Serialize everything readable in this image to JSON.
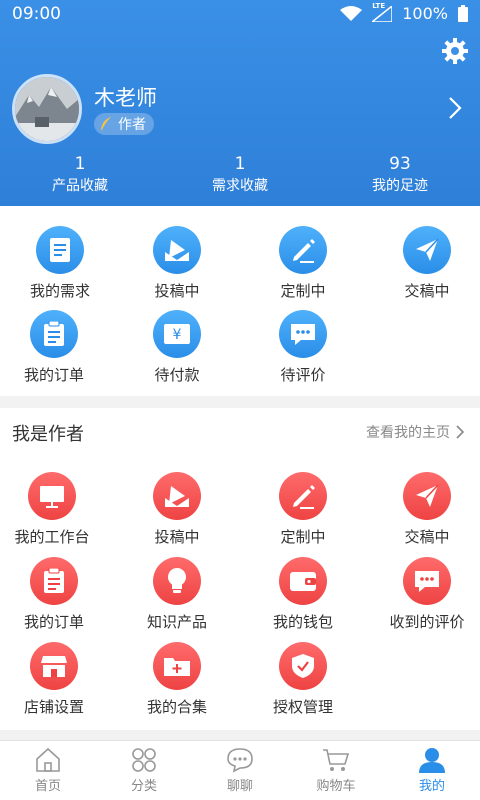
{
  "status": {
    "time": "09:00",
    "network": "LTE",
    "battery": "100%"
  },
  "profile": {
    "name": "木老师",
    "role": "作者"
  },
  "stats": [
    {
      "value": "1",
      "label": "产品收藏"
    },
    {
      "value": "1",
      "label": "需求收藏"
    },
    {
      "value": "93",
      "label": "我的足迹"
    }
  ],
  "buyer_menu": [
    {
      "label": "我的需求",
      "icon": "document-icon"
    },
    {
      "label": "投稿中",
      "icon": "envelope-icon"
    },
    {
      "label": "定制中",
      "icon": "pencil-icon"
    },
    {
      "label": "交稿中",
      "icon": "paper-plane-icon"
    },
    {
      "label": "我的订单",
      "icon": "order-icon"
    },
    {
      "label": "待付款",
      "icon": "yen-icon"
    },
    {
      "label": "待评价",
      "icon": "chat-bubble-icon"
    }
  ],
  "author_section": {
    "title": "我是作者",
    "link": "查看我的主页"
  },
  "author_menu": [
    {
      "label": "我的工作台",
      "icon": "monitor-icon"
    },
    {
      "label": "投稿中",
      "icon": "envelope-icon"
    },
    {
      "label": "定制中",
      "icon": "pencil-icon"
    },
    {
      "label": "交稿中",
      "icon": "paper-plane-icon"
    },
    {
      "label": "我的订单",
      "icon": "order-icon"
    },
    {
      "label": "知识产品",
      "icon": "lightbulb-icon"
    },
    {
      "label": "我的钱包",
      "icon": "wallet-icon"
    },
    {
      "label": "收到的评价",
      "icon": "chat-bubble-icon"
    },
    {
      "label": "店铺设置",
      "icon": "store-icon"
    },
    {
      "label": "我的合集",
      "icon": "folder-plus-icon"
    },
    {
      "label": "授权管理",
      "icon": "shield-check-icon"
    }
  ],
  "bottom_nav": [
    {
      "label": "首页",
      "icon": "home-icon"
    },
    {
      "label": "分类",
      "icon": "category-icon"
    },
    {
      "label": "聊聊",
      "icon": "chat-icon"
    },
    {
      "label": "购物车",
      "icon": "cart-icon"
    },
    {
      "label": "我的",
      "icon": "user-icon",
      "active": true
    }
  ],
  "colors": {
    "header": "#3a90e6",
    "blue_icon": "#2a8ee8",
    "red_icon": "#ee4343",
    "active_nav": "#2a8ee8"
  }
}
